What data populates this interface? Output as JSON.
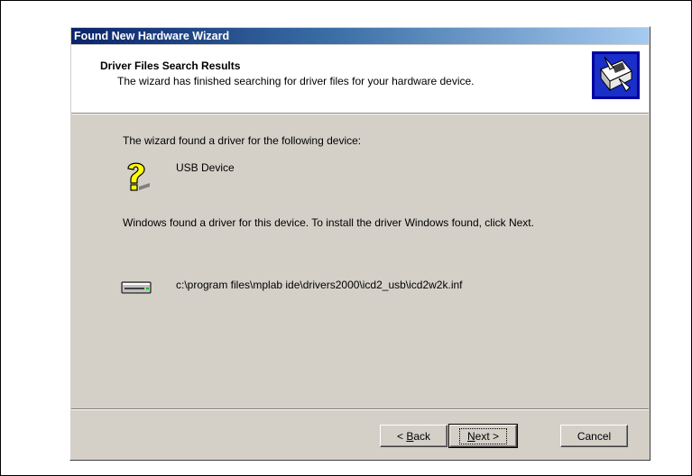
{
  "dialog": {
    "title": "Found New Hardware Wizard",
    "header_title": "Driver Files Search Results",
    "header_subtitle": "The wizard has finished searching for driver files for your hardware device.",
    "header_icon": "hardware-wizard-icon"
  },
  "content": {
    "found_text": "The wizard found a driver for the following device:",
    "device_icon": "unknown-device-question-icon",
    "device_name": "USB Device",
    "install_text": "Windows found a driver for this device. To install the driver Windows found, click Next.",
    "driver_icon": "disk-drive-icon",
    "driver_path": "c:\\program files\\mplab ide\\drivers2000\\icd2_usb\\icd2w2k.inf"
  },
  "buttons": {
    "back_prefix": "< ",
    "back_accel": "B",
    "back_rest": "ack",
    "next_accel": "N",
    "next_rest": "ext >",
    "cancel": "Cancel"
  },
  "colors": {
    "dialog_face": "#d4d0c8",
    "titlebar_start": "#0a246a",
    "titlebar_end": "#a6caf0"
  }
}
